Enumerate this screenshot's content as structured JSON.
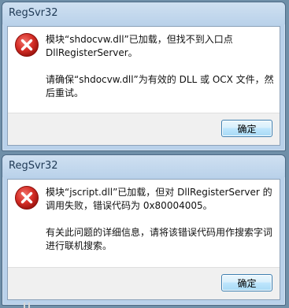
{
  "dialogs": [
    {
      "title": "RegSvr32",
      "message_1": "模块“shdocvw.dll”已加载，但找不到入口点 DllRegisterServer。",
      "message_2": "请确保“shdocvw.dll”为有效的 DLL 或 OCX 文件，然后重试。",
      "ok_label": "确定",
      "icon": "error-icon"
    },
    {
      "title": "RegSvr32",
      "message_1": "模块“jscript.dll”已加载，但对 DllRegisterServer 的调用失败，错误代码为 0x80004005。",
      "message_2": "有关此问题的详细信息，请将该错误代码用作搜索字词进行联机搜索。",
      "ok_label": "确定",
      "icon": "error-icon"
    }
  ],
  "colors": {
    "error_red": "#d32f2f",
    "frame": "#b9d1ea",
    "button_border": "#3c7fb1"
  }
}
